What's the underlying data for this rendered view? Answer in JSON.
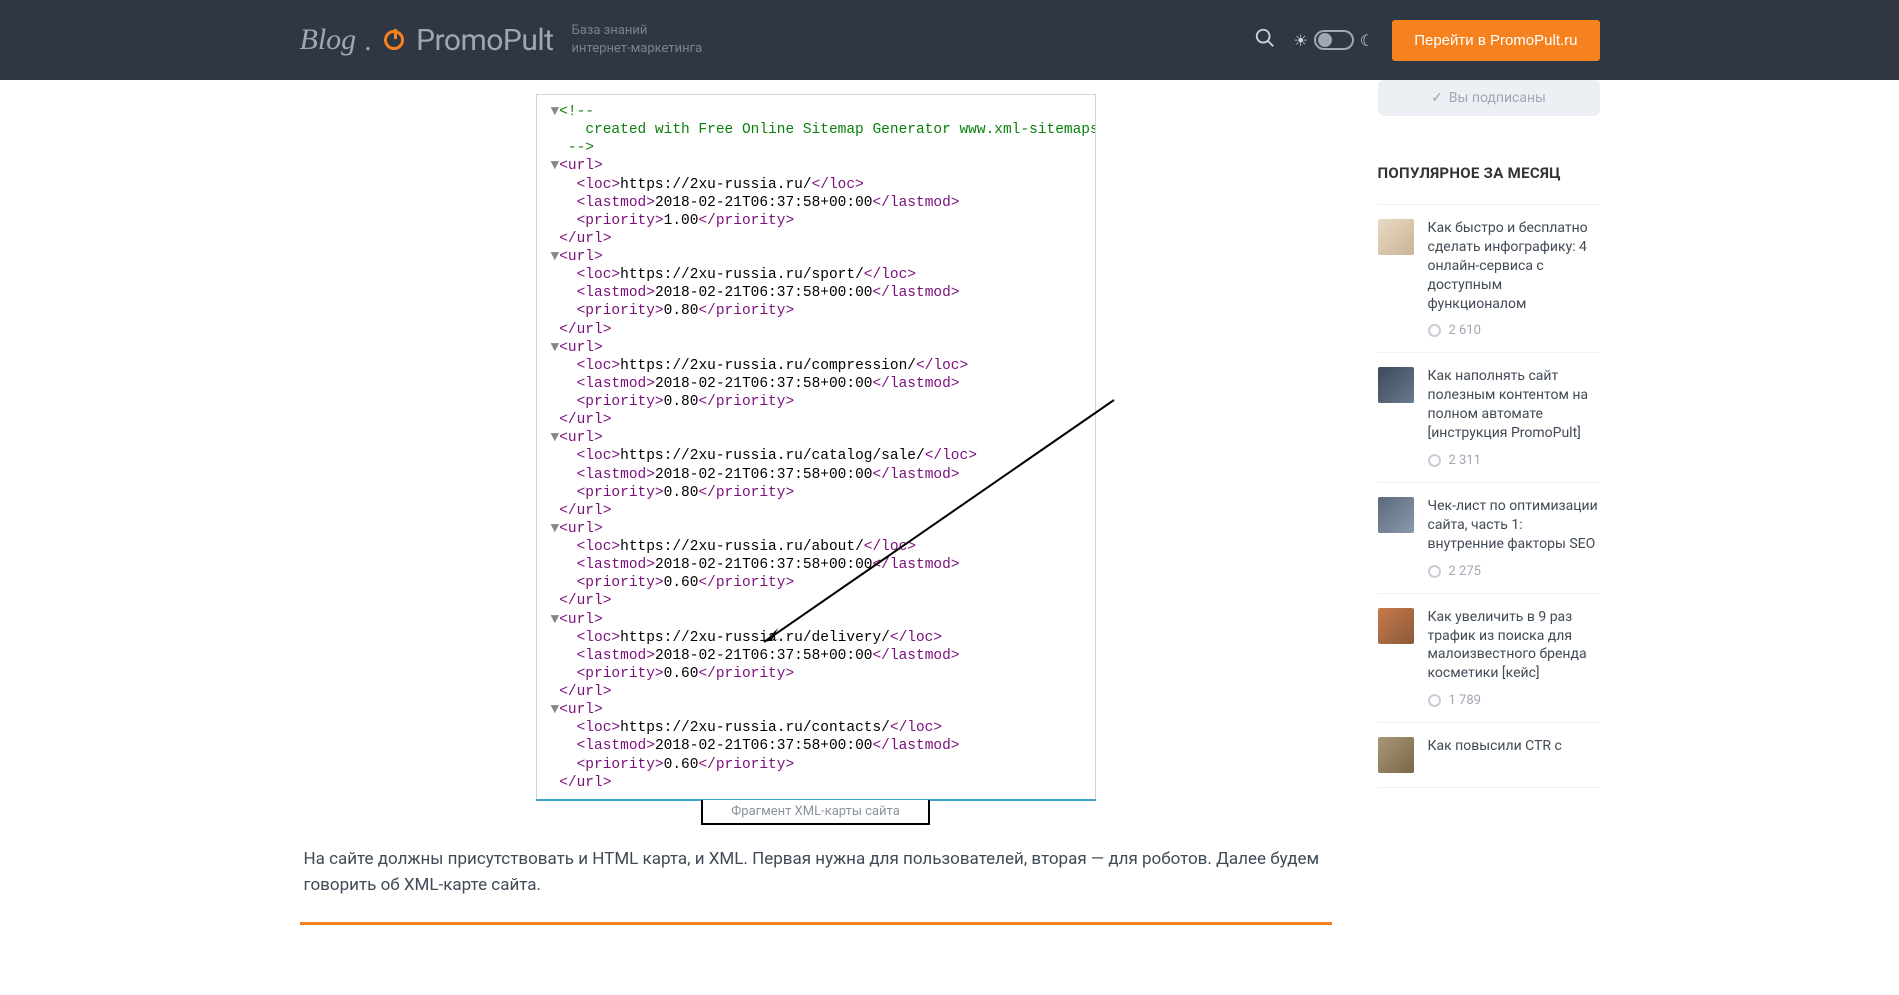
{
  "header": {
    "logo_blog": "Blog",
    "logo_brand": "PromoPult",
    "tagline_l1": "База знаний",
    "tagline_l2": "интернет-маркетинга",
    "cta": "Перейти в PromoPult.ru"
  },
  "subscribe": {
    "label": "Вы подписаны"
  },
  "sidebar_title": "ПОПУЛЯРНОЕ ЗА МЕСЯЦ",
  "popular": [
    {
      "title": "Как быстро и бесплатно сделать инфографику: 4 онлайн-сервиса с доступным функционалом",
      "views": "2 610"
    },
    {
      "title": "Как наполнять сайт полезным контентом на полном автомате [инструкция PromoPult]",
      "views": "2 311"
    },
    {
      "title": "Чек-лист по оптимизации сайта, часть 1: внутренние факторы SEO",
      "views": "2 275"
    },
    {
      "title": "Как увеличить в 9 раз трафик из поиска для малоизвестного бренда косметики [кейс]",
      "views": "1 789"
    },
    {
      "title": "Как повысили CTR с",
      "views": ""
    }
  ],
  "xml": {
    "comment": "created with Free Online Sitemap Generator www.xml-sitemaps.com",
    "lastmod": "2018-02-21T06:37:58+00:00",
    "entries": [
      {
        "loc": "https://2xu-russia.ru/",
        "priority": "1.00"
      },
      {
        "loc": "https://2xu-russia.ru/sport/",
        "priority": "0.80"
      },
      {
        "loc": "https://2xu-russia.ru/compression/",
        "priority": "0.80"
      },
      {
        "loc": "https://2xu-russia.ru/catalog/sale/",
        "priority": "0.80"
      },
      {
        "loc": "https://2xu-russia.ru/about/",
        "priority": "0.60"
      },
      {
        "loc": "https://2xu-russia.ru/delivery/",
        "priority": "0.60"
      },
      {
        "loc": "https://2xu-russia.ru/contacts/",
        "priority": "0.60"
      }
    ]
  },
  "caption": "Фрагмент XML-карты сайта",
  "article_paragraph": "На сайте должны присутствовать и HTML карта, и XML. Первая нужна для пользователей, вторая — для роботов. Далее будем говорить об XML-карте сайта."
}
